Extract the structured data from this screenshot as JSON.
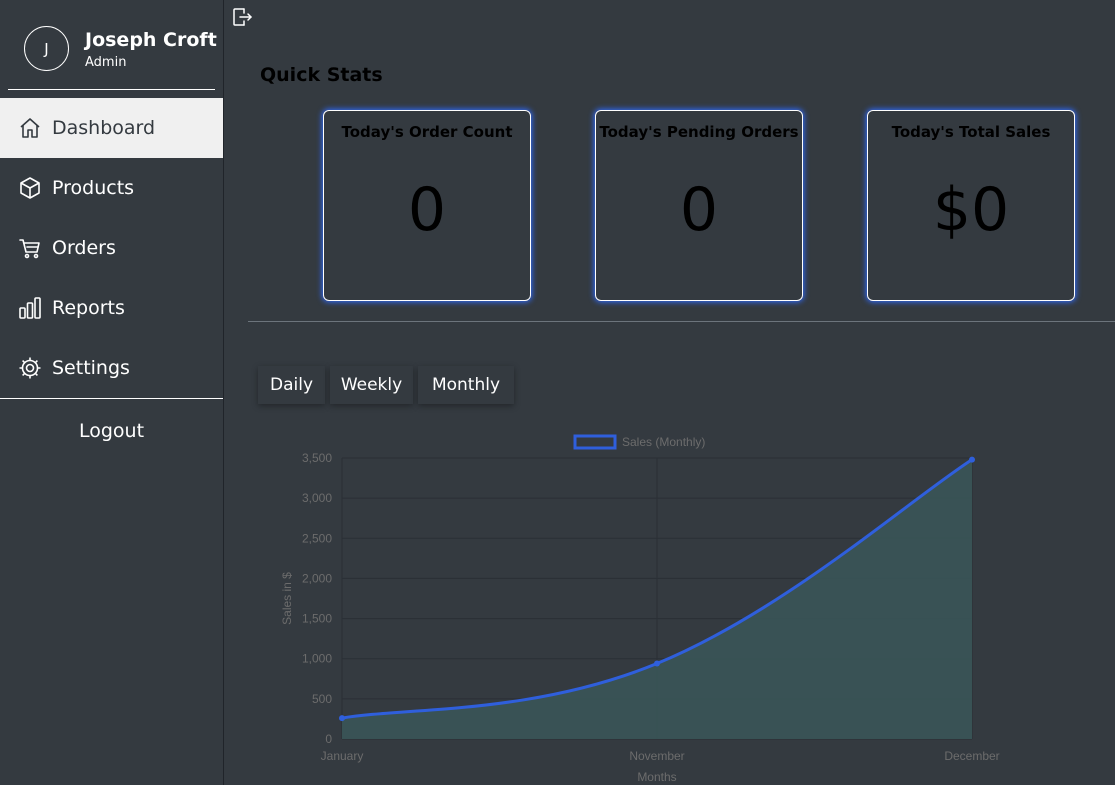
{
  "user": {
    "initial": "J",
    "name": "Joseph Croft",
    "role": "Admin"
  },
  "nav": [
    {
      "label": "Dashboard",
      "icon": "home-icon",
      "active": true
    },
    {
      "label": "Products",
      "icon": "box-icon",
      "active": false
    },
    {
      "label": "Orders",
      "icon": "cart-icon",
      "active": false
    },
    {
      "label": "Reports",
      "icon": "bar-chart-icon",
      "active": false
    },
    {
      "label": "Settings",
      "icon": "gear-icon",
      "active": false
    }
  ],
  "logout_label": "Logout",
  "header": {
    "exit_icon": "exit-icon"
  },
  "quick_stats": {
    "title": "Quick Stats",
    "cards": [
      {
        "label": "Today's Order Count",
        "value": "0"
      },
      {
        "label": "Today's Pending Orders",
        "value": "0"
      },
      {
        "label": "Today's Total Sales",
        "value": "$0"
      }
    ]
  },
  "period_buttons": [
    "Daily",
    "Weekly",
    "Monthly"
  ],
  "colors": {
    "background": "#343a40",
    "accent": "#2f5fdc",
    "area_fill": "#3a5558",
    "active_nav": "#f0f0f0"
  },
  "chart_data": {
    "type": "area",
    "categories": [
      "January",
      "November",
      "December"
    ],
    "series": [
      {
        "name": "Sales (Monthly)",
        "values": [
          260,
          940,
          3480
        ]
      }
    ],
    "xlabel": "Months",
    "ylabel": "Sales in $",
    "ylim": [
      0,
      3500
    ],
    "yticks": [
      "0",
      "500",
      "1,000",
      "1,500",
      "2,000",
      "2,500",
      "3,000",
      "3,500"
    ],
    "grid": true,
    "legend": "top"
  }
}
